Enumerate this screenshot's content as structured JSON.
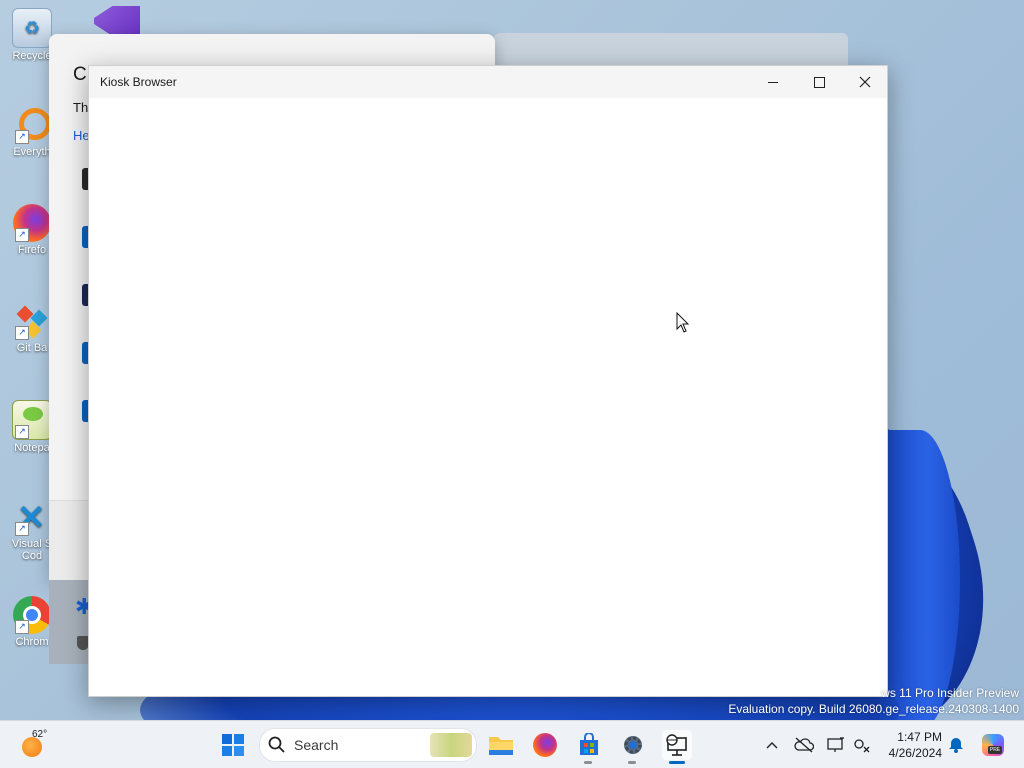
{
  "desktop": {
    "icons": [
      {
        "label": "Recycle",
        "icon": "recycle-bin-icon"
      },
      {
        "label": "Everyth",
        "icon": "everything-search-icon"
      },
      {
        "label": "Firefo",
        "icon": "firefox-icon"
      },
      {
        "label": "Git Ba",
        "icon": "git-bash-icon"
      },
      {
        "label": "Notepa",
        "icon": "notepad-plus-icon"
      },
      {
        "label": "Visual S",
        "label2": "Cod",
        "icon": "vscode-icon"
      },
      {
        "label": "Chrom",
        "icon": "chrome-icon"
      }
    ]
  },
  "background_window": {
    "heading": "C",
    "line": "Th",
    "link": "He"
  },
  "kiosk_window": {
    "title": "Kiosk Browser",
    "minimize_label": "Minimize",
    "maximize_label": "Maximize",
    "close_label": "Close"
  },
  "watermark": {
    "line1": "ws 11 Pro Insider Preview",
    "line2": "Evaluation copy. Build 26080.ge_release.240308-1400"
  },
  "taskbar": {
    "weather_temp": "62°",
    "search_placeholder": "Search",
    "apps": [
      "start-icon",
      "file-explorer-icon",
      "firefox-icon",
      "store-icon",
      "settings-icon",
      "kiosk-browser-icon"
    ],
    "tray": [
      "chevron-up-icon",
      "onedrive-offline-icon",
      "display-icon",
      "network-icon",
      "notification-bell-icon",
      "copilot-icon"
    ],
    "time": "1:47 PM",
    "date": "4/26/2024",
    "accent": "#0067c0"
  }
}
